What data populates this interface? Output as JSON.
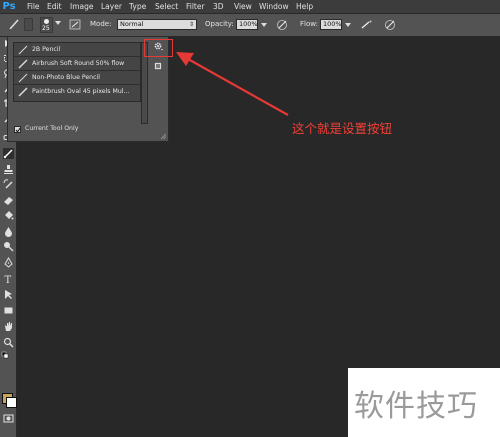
{
  "app": {
    "logo": "Ps"
  },
  "menu": [
    "File",
    "Edit",
    "Image",
    "Layer",
    "Type",
    "Select",
    "Filter",
    "3D",
    "View",
    "Window",
    "Help"
  ],
  "options_bar": {
    "brush_size": "25",
    "mode_label": "Mode:",
    "mode_value": "Normal",
    "opacity_label": "Opacity:",
    "opacity_value": "100%",
    "flow_label": "Flow:",
    "flow_value": "100%"
  },
  "brush_presets": {
    "items": [
      {
        "label": "2B Pencil"
      },
      {
        "label": "Airbrush Soft Round 50% flow"
      },
      {
        "label": "Non-Photo Blue Pencil"
      },
      {
        "label": "Paintbrush Oval 45 pixels Mul..."
      }
    ],
    "current_tool_only_label": "Current Tool Only",
    "current_tool_only_checked": true
  },
  "annotation": {
    "text": "这个就是设置按钮",
    "color": "#e53935"
  },
  "watermark": {
    "text": "软件技巧"
  },
  "colors": {
    "foreground": "#c9a35c",
    "background": "#ffffff",
    "canvas": "#282828",
    "panel": "#535353"
  }
}
